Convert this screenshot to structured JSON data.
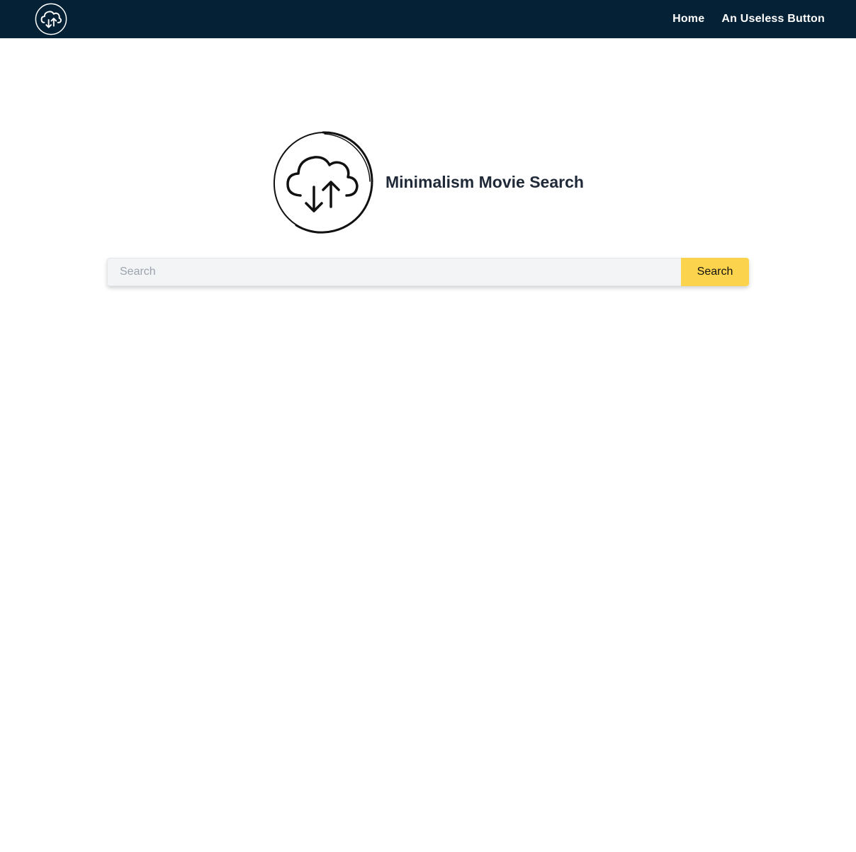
{
  "nav": {
    "logo_icon": "cloud-sync-icon",
    "links": [
      {
        "label": "Home"
      },
      {
        "label": "An Useless Button"
      }
    ]
  },
  "hero": {
    "logo_icon": "cloud-sync-icon",
    "title": "Minimalism Movie Search"
  },
  "search": {
    "placeholder": "Search",
    "value": "",
    "button_label": "Search"
  },
  "colors": {
    "navbar_bg": "#052135",
    "search_button_bg": "#fcd34d",
    "title_text": "#1f2937"
  }
}
